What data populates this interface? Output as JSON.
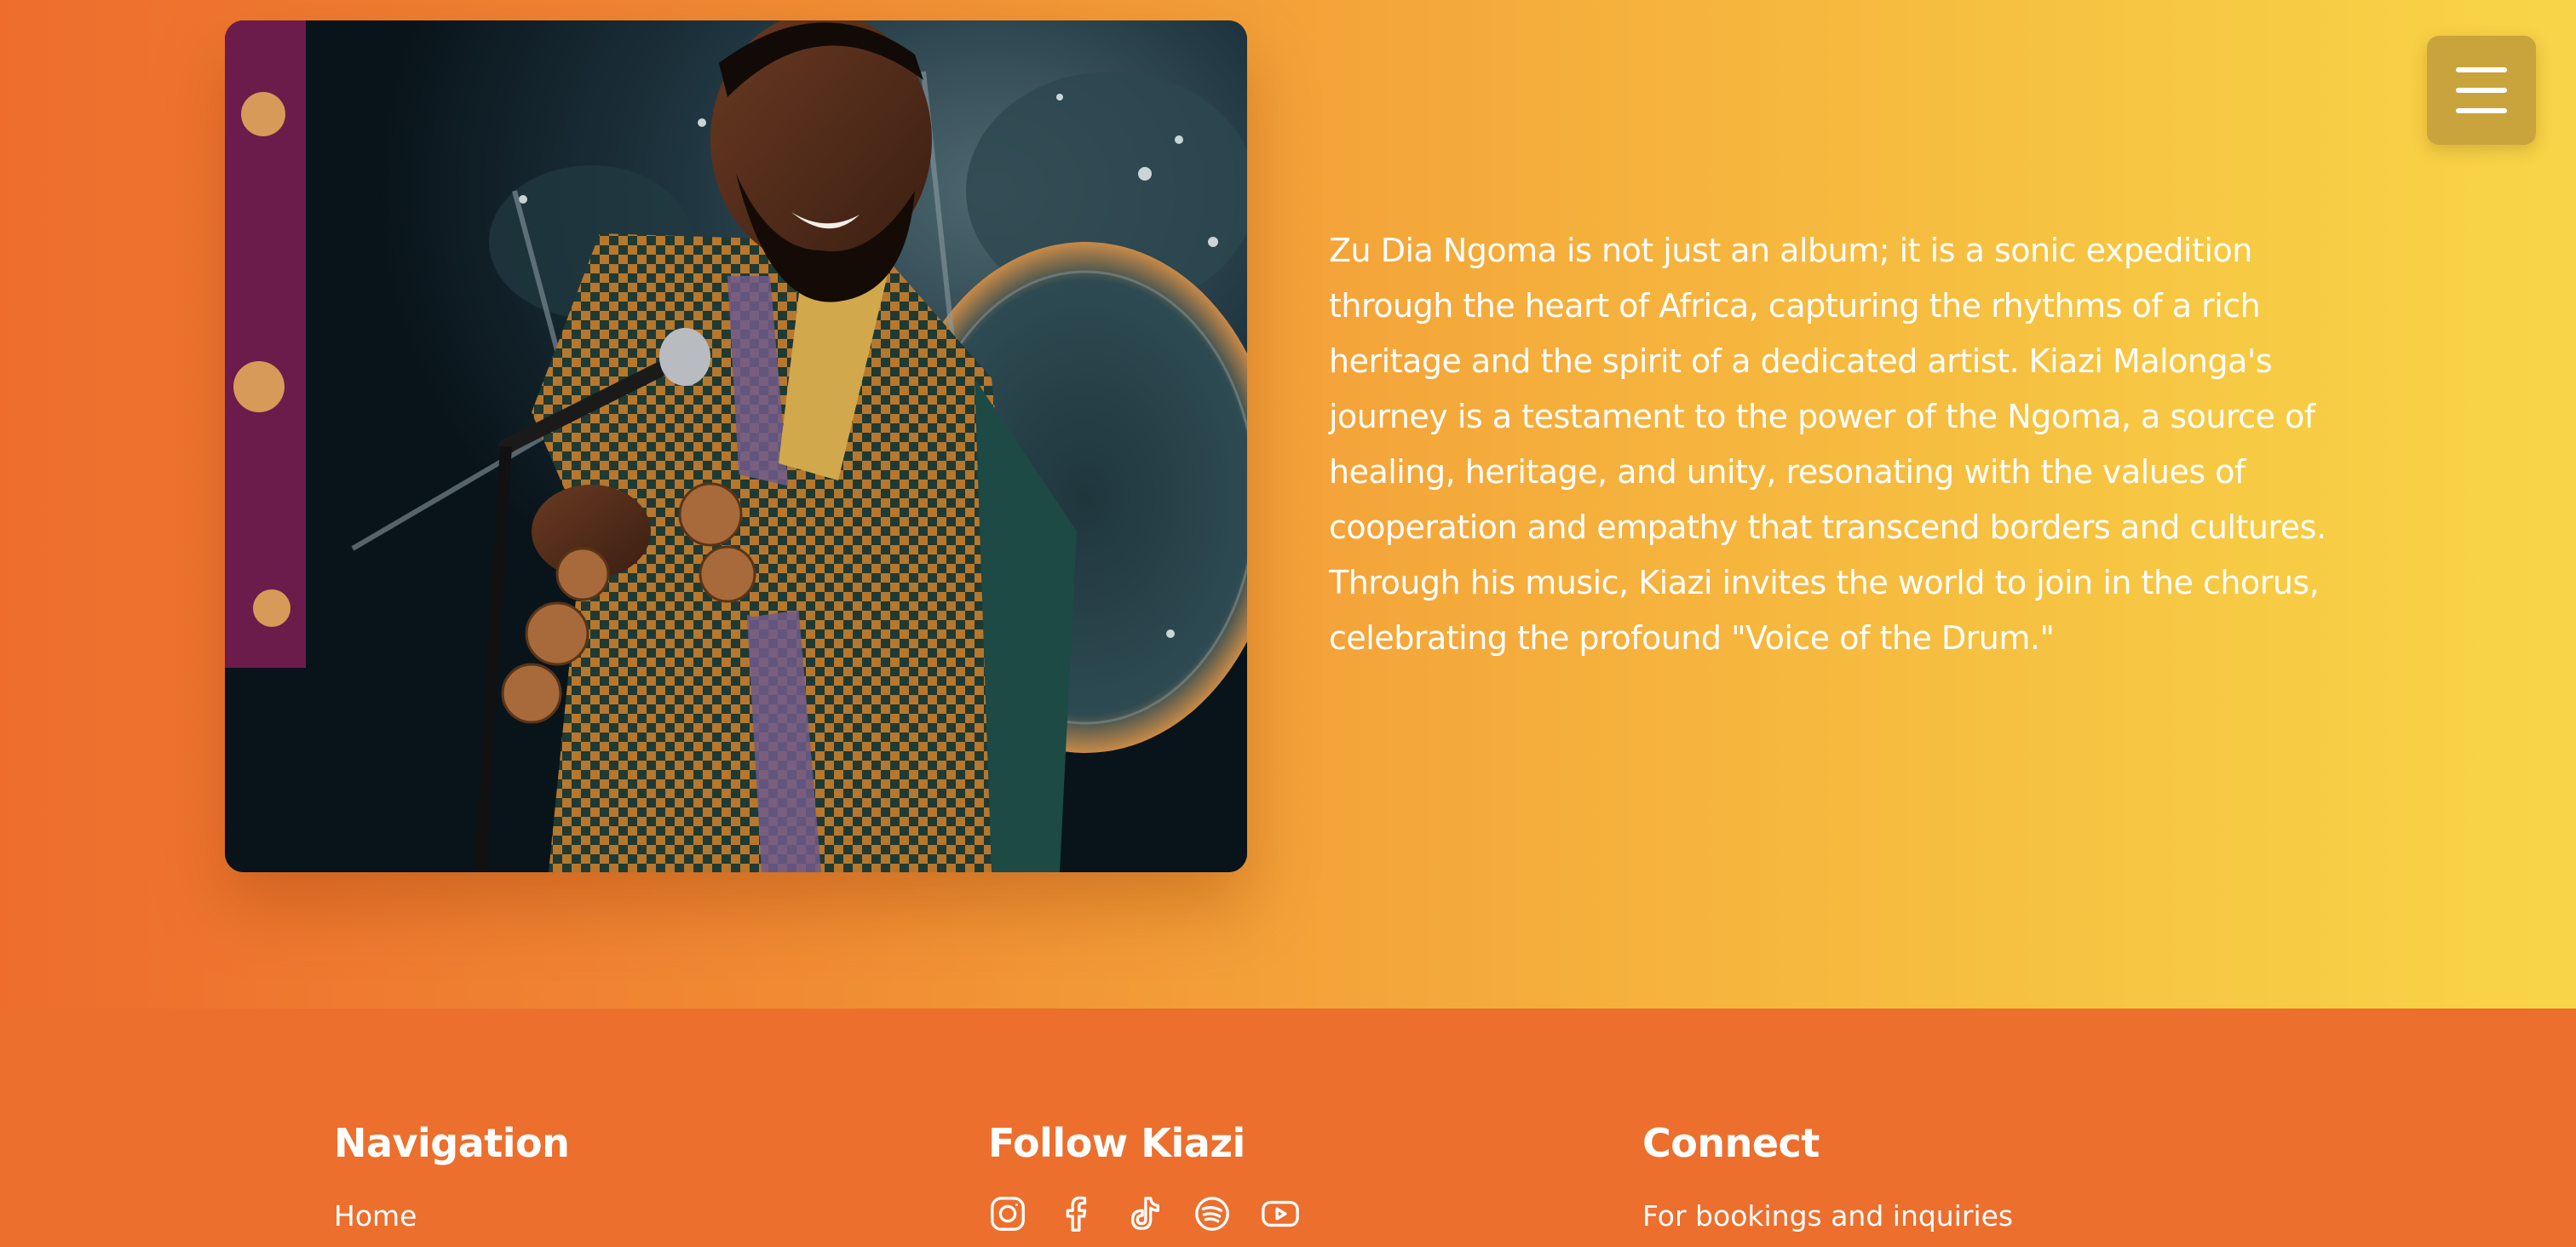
{
  "menu": {
    "icon": "hamburger-menu-icon"
  },
  "photo": {
    "subject": "performer-with-microphone-photo"
  },
  "about": {
    "text": "Zu Dia Ngoma is not just an album; it is a sonic expedition through the heart of Africa, capturing the rhythms of a rich heritage and the spirit of a dedicated artist. Kiazi Malonga's journey is a testament to the power of the Ngoma, a source of healing, heritage, and unity, resonating with the values of cooperation and empathy that transcend borders and cultures. Through his music, Kiazi invites the world to join in the chorus, celebrating the profound \"Voice of the Drum.\""
  },
  "footer": {
    "navigation": {
      "heading": "Navigation",
      "links": [
        "Home"
      ]
    },
    "follow": {
      "heading": "Follow Kiazi",
      "icons": [
        "instagram-icon",
        "facebook-icon",
        "tiktok-icon",
        "spotify-icon",
        "youtube-icon"
      ]
    },
    "connect": {
      "heading": "Connect",
      "text": "For bookings and inquiries"
    }
  },
  "colors": {
    "gradient_start": "#ee6d2d",
    "gradient_end": "#f8d548",
    "footer_bg": "#ec6f2d",
    "menu_button_bg": "#c9a43c",
    "text": "#ffffff"
  }
}
